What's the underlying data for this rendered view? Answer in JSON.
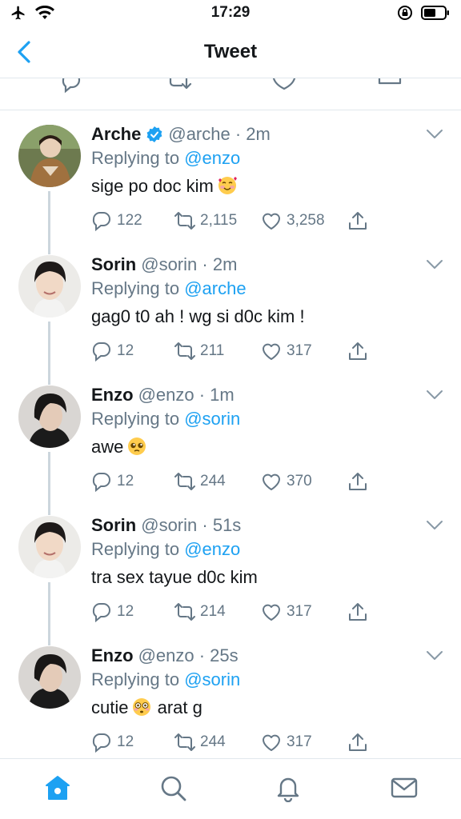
{
  "status_bar": {
    "time": "17:29",
    "left_icons": [
      "airplane-icon",
      "wifi-icon"
    ],
    "right_icons": [
      "orientation-lock-icon",
      "battery-icon"
    ]
  },
  "nav": {
    "title": "Tweet",
    "back_icon": "chevron-left-icon"
  },
  "colors": {
    "accent": "#1da1f2",
    "muted": "#657786",
    "text": "#14171a",
    "divider": "#e1e8ed",
    "verified": "#1da1f2"
  },
  "replies": [
    {
      "name": "Arche",
      "verified": true,
      "handle": "@arche",
      "time": "2m",
      "replying_label": "Replying to",
      "replying_to": "@enzo",
      "text": "sige po doc kim",
      "emoji": "smiling-face-with-hearts",
      "reply_count": "122",
      "retweet_count": "2,115",
      "like_count": "3,258"
    },
    {
      "name": "Sorin",
      "verified": false,
      "handle": "@sorin",
      "time": "2m",
      "replying_label": "Replying to",
      "replying_to": "@arche",
      "text": "gag0 t0 ah ! wg si d0c kim !",
      "emoji": "",
      "reply_count": "12",
      "retweet_count": "211",
      "like_count": "317"
    },
    {
      "name": "Enzo",
      "verified": false,
      "handle": "@enzo",
      "time": "1m",
      "replying_label": "Replying to",
      "replying_to": "@sorin",
      "text": "awe",
      "emoji": "pleading-face",
      "reply_count": "12",
      "retweet_count": "244",
      "like_count": "370"
    },
    {
      "name": "Sorin",
      "verified": false,
      "handle": "@sorin",
      "time": "51s",
      "replying_label": "Replying to",
      "replying_to": "@enzo",
      "text": "tra sex tayue d0c kim",
      "emoji": "",
      "reply_count": "12",
      "retweet_count": "214",
      "like_count": "317"
    },
    {
      "name": "Enzo",
      "verified": false,
      "handle": "@enzo",
      "time": "25s",
      "replying_label": "Replying to",
      "replying_to": "@sorin",
      "text": "cutie",
      "emoji": "flushed-face",
      "text_after": "arat g",
      "reply_count": "12",
      "retweet_count": "244",
      "like_count": "317"
    }
  ],
  "tab_bar": {
    "tabs": [
      "home-icon",
      "search-icon",
      "notifications-icon",
      "messages-icon"
    ],
    "active": "home-icon"
  }
}
